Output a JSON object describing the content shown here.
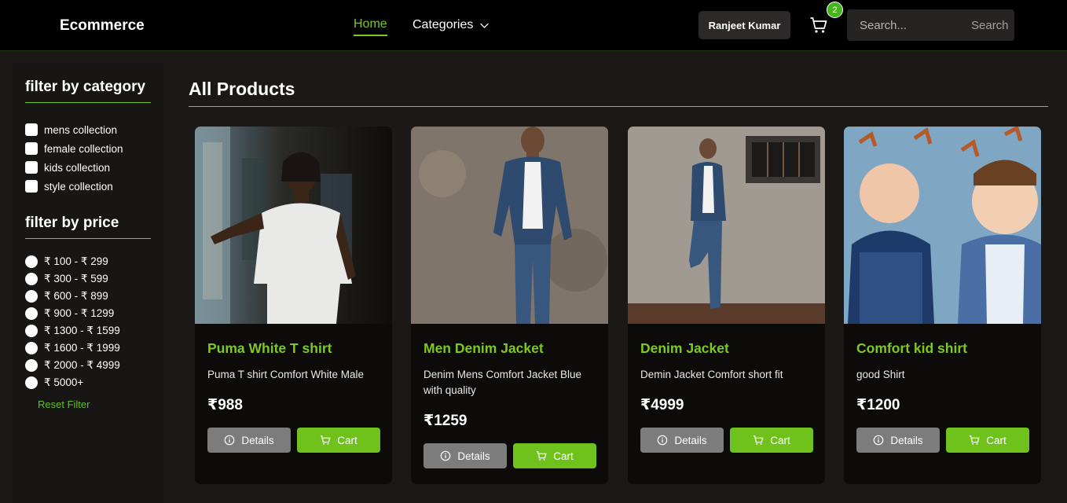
{
  "navbar": {
    "brand": "Ecommerce",
    "home": "Home",
    "categories": "Categories",
    "user": "Ranjeet Kumar",
    "cart_count": "2",
    "search_placeholder": "Search...",
    "search_button": "Search"
  },
  "sidebar": {
    "category_title": "filter by category",
    "categories": [
      "mens collection",
      "female collection",
      "kids collection",
      "style collection"
    ],
    "price_title": "filter by price",
    "prices": [
      "₹ 100 - ₹ 299",
      "₹ 300 - ₹ 599",
      "₹ 600 - ₹ 899",
      "₹ 900 - ₹ 1299",
      "₹ 1300 - ₹ 1599",
      "₹ 1600 - ₹ 1999",
      "₹ 2000 - ₹ 4999",
      "₹ 5000+"
    ],
    "reset": "Reset Filter"
  },
  "main": {
    "title": "All Products",
    "products": [
      {
        "name": "Puma White T shirt",
        "desc": "Puma T shirt Comfort White Male",
        "price": "₹988",
        "details": "Details",
        "cart": "Cart"
      },
      {
        "name": "Men Denim Jacket",
        "desc": "Denim Mens Comfort Jacket Blue with quality",
        "price": "₹1259",
        "details": "Details",
        "cart": "Cart"
      },
      {
        "name": "Denim Jacket",
        "desc": "Demin Jacket Comfort short fit",
        "price": "₹4999",
        "details": "Details",
        "cart": "Cart"
      },
      {
        "name": "Comfort kid shirt",
        "desc": "good Shirt",
        "price": "₹1200",
        "details": "Details",
        "cart": "Cart"
      }
    ]
  },
  "colors": {
    "accent": "#7ec820",
    "cart_button": "#6fc21b",
    "details_button": "#7c7c7c",
    "badge": "#46b51c"
  }
}
